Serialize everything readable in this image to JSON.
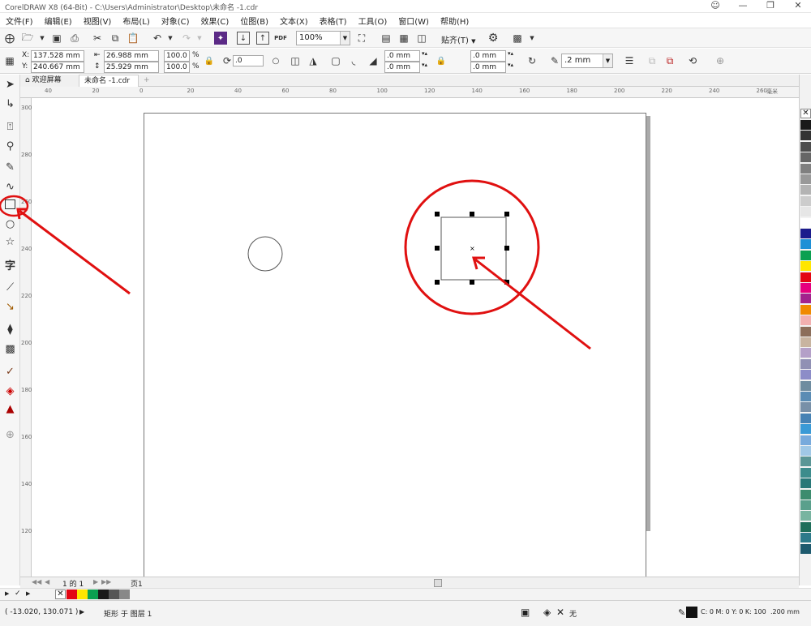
{
  "window": {
    "title": "CorelDRAW X8 (64-Bit) - C:\\Users\\Administrator\\Desktop\\未命名 -1.cdr"
  },
  "menu": [
    "文件(F)",
    "编辑(E)",
    "视图(V)",
    "布局(L)",
    "对象(C)",
    "效果(C)",
    "位图(B)",
    "文本(X)",
    "表格(T)",
    "工具(O)",
    "窗口(W)",
    "帮助(H)"
  ],
  "standard_toolbar": {
    "zoom": "100%",
    "snap": "贴齐(T)",
    "pdf_label": "PDF"
  },
  "property_bar": {
    "x": "137.528 mm",
    "y": "240.667 mm",
    "width": "26.988 mm",
    "height": "25.929 mm",
    "scale_x": "100.0",
    "scale_y": "100.0",
    "percent": "%",
    "rotation": ".0",
    "corner_1": ".0 mm",
    "corner_2": ".0 mm",
    "corner_3": ".0 mm",
    "corner_4": ".0 mm",
    "outline_width": ".2 mm",
    "x_label": "X:",
    "y_label": "Y:"
  },
  "tabs": [
    "欢迎屏幕",
    "未命名 -1.cdr"
  ],
  "ruler": {
    "horizontal": [
      "40",
      "20",
      "0",
      "20",
      "40",
      "60",
      "80",
      "100",
      "120",
      "140",
      "160",
      "180",
      "200",
      "220",
      "240",
      "260"
    ],
    "horizontal_unit": "毫米",
    "vertical": [
      "300",
      "280",
      "260",
      "240",
      "220",
      "200",
      "180",
      "160",
      "140",
      "120"
    ]
  },
  "page_nav": {
    "page_of": "1 的 1",
    "page_tab": "页1"
  },
  "status": {
    "coords": "( -13.020, 130.071 )",
    "object_info": "矩形 于 图层 1",
    "fill": "无",
    "outline_color": "C: 0 M: 0 Y: 0 K: 100",
    "outline_width": ".200 mm"
  },
  "colors": {
    "annotation_red": "#e01010",
    "palette": [
      "#1a1a1a",
      "#333333",
      "#4d4d4d",
      "#666666",
      "#808080",
      "#999999",
      "#b3b3b3",
      "#cccccc",
      "#e6e6e6",
      "#ffffff",
      "#1b1b8c",
      "#1e90d6",
      "#0aa050",
      "#ffe600",
      "#e30613",
      "#e6007e",
      "#a3228d",
      "#f08a00",
      "#f2b0b0",
      "#8c6e5a",
      "#c8b4a0",
      "#b4a0c8",
      "#9090b4",
      "#8c8cc8",
      "#6e8ca0",
      "#5a8cb4",
      "#7890a8",
      "#4682b4",
      "#3a9ad6",
      "#78aadc",
      "#a0c8e6",
      "#5a9696",
      "#3c8c8c",
      "#287878",
      "#3c8c6e",
      "#5aa08c",
      "#78b4a0",
      "#1e6e5a",
      "#2c7a8a",
      "#1e5a6e"
    ],
    "doc_palette": [
      "#e30613",
      "#ffe600",
      "#0aa050",
      "#1a1a1a",
      "#555555",
      "#888888"
    ]
  }
}
